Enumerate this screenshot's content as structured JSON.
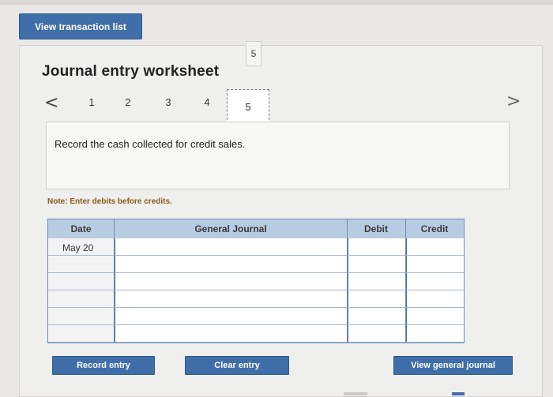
{
  "header": {
    "view_transactions_label": "View transaction list"
  },
  "worksheet": {
    "page_badge": "5",
    "title": "Journal entry worksheet",
    "nav": {
      "prev_symbol": "<",
      "next_symbol": ">",
      "pages": [
        "1",
        "2",
        "3",
        "4",
        "5"
      ],
      "active_page": "5"
    },
    "prompt": "Record the cash collected for credit sales.",
    "note_label": "Note:",
    "note_text": " Enter debits before credits."
  },
  "table": {
    "columns": [
      "Date",
      "General Journal",
      "Debit",
      "Credit"
    ],
    "rows": [
      {
        "date": "May 20",
        "account": "",
        "debit": "",
        "credit": ""
      },
      {
        "date": "",
        "account": "",
        "debit": "",
        "credit": ""
      },
      {
        "date": "",
        "account": "",
        "debit": "",
        "credit": ""
      },
      {
        "date": "",
        "account": "",
        "debit": "",
        "credit": ""
      },
      {
        "date": "",
        "account": "",
        "debit": "",
        "credit": ""
      },
      {
        "date": "",
        "account": "",
        "debit": "",
        "credit": ""
      }
    ]
  },
  "actions": {
    "record_entry": "Record entry",
    "clear_entry": "Clear entry",
    "view_general_journal": "View general journal"
  },
  "colors": {
    "accent_blue": "#3f6ea8",
    "table_header": "#b9cbe3",
    "note_color": "#8a5a1a"
  }
}
